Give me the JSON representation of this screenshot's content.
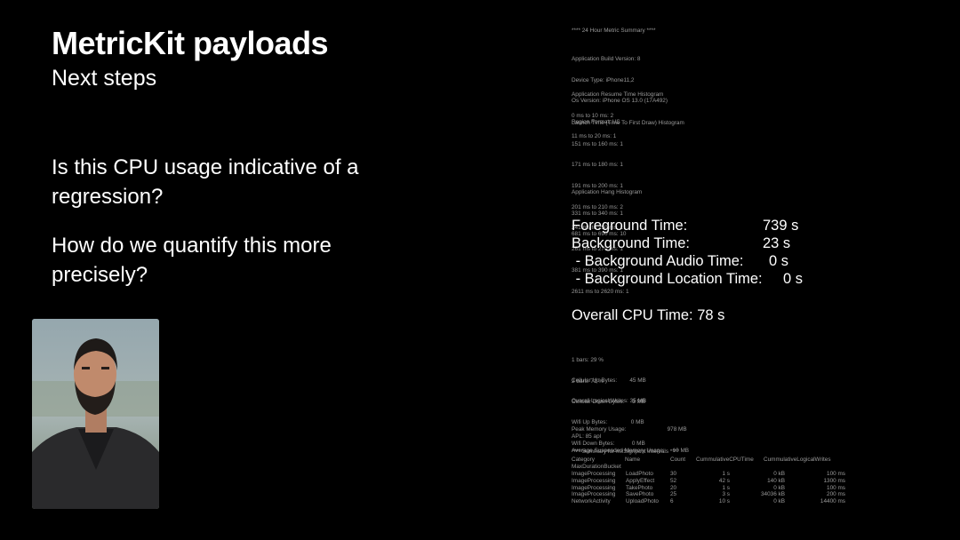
{
  "slide": {
    "title": "MetricKit payloads",
    "subtitle": "Next steps",
    "question_1": "Is this CPU usage indicative of a regression?",
    "question_2": "How do we quantify this more precisely?"
  },
  "report": {
    "header": "**** 24 Hour Metric Summary ****",
    "device_info": [
      "Application Build Version: 8",
      "Device Type: iPhone11,2",
      "Os Version: iPhone OS 13.0 (17A492)",
      "Region Format: US"
    ],
    "resume_histogram": [
      "Application Resume Time Histogram",
      "0 ms to 10 ms: 2",
      "11 ms to 20 ms: 1"
    ],
    "launch_histogram": [
      "Launch Time (Time To First Draw) Histogram",
      "151 ms to 160 ms: 1",
      "171 ms to 180 ms: 1",
      "191 ms to 200 ms: 1",
      "201 ms to 210 ms: 2",
      "241 ms to 250 ms: 1",
      "261 ms to 270 ms: 1",
      "381 ms to 390 ms: 1",
      "2611 ms to 2620 ms: 1"
    ],
    "hang_histogram": [
      "Application Hang Histogram",
      "331 ms to 340 ms: 1",
      "681 ms to 690 ms: 10"
    ],
    "foreground_time": {
      "label": "Foreground Time:",
      "value": "739 s"
    },
    "background_time": {
      "label": "Background Time:",
      "value": "23 s"
    },
    "background_audio": {
      "label": " - Background Audio Time:",
      "value": "0 s"
    },
    "background_location": {
      "label": " - Background Location Time:",
      "value": "0 s"
    },
    "overall_cpu": "Overall CPU Time: 78 s",
    "bars": [
      "1 bars: 29 %",
      "2 bars: 71 %"
    ],
    "network": [
      "Cellular Up Bytes:        45 MB",
      "Cellular Down Bytes:     3 MB",
      "Wifi Up Bytes:               0 MB",
      "Wifi Down Bytes:           0 MB"
    ],
    "logical_writes": "Overall Logical Writes: 35 MB",
    "memory": [
      "Peak Memory Usage:                          978 MB",
      "Average Suspended Memory Usage:     10 MB"
    ],
    "apl": "APL: 85 apl",
    "signpost_header": "**** Summary for mxSignpost intervals ****",
    "signpost_columns": [
      "Category",
      "Name",
      "Count",
      "CummulativeCPUTime",
      "CummulativeLogicalWrites"
    ],
    "signpost_column_extra": "MaxDurationBucket",
    "signpost_rows": [
      [
        "ImageProcessing",
        "LoadPhoto",
        "30",
        "1 s",
        "0 kB",
        "100 ms"
      ],
      [
        "ImageProcessing",
        "ApplyEffect",
        "52",
        "42 s",
        "140 kB",
        "1300 ms"
      ],
      [
        "ImageProcessing",
        "TakePhoto",
        "20",
        "1 s",
        "0 kB",
        "100 ms"
      ],
      [
        "ImageProcessing",
        "SavePhoto",
        "25",
        "3 s",
        "34036 kB",
        "200 ms"
      ],
      [
        "NetworkActivity",
        "UploadPhoto",
        "6",
        "10 s",
        "0 kB",
        "14400 ms"
      ]
    ]
  }
}
